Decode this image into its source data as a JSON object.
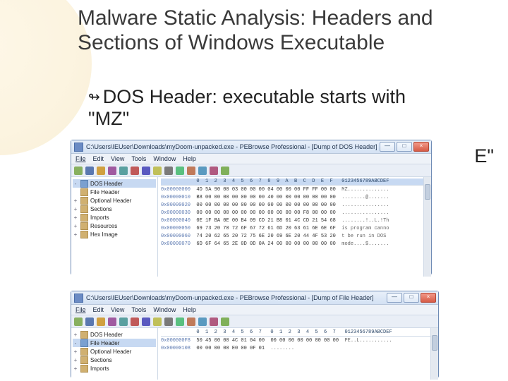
{
  "slide": {
    "title": "Malware Static Analysis: Headers and Sections of Windows Executable",
    "bullet1_prefix": "DOS Header:  executable starts with",
    "bullet1_mz": "\"MZ\"",
    "pe_fragment": "E\""
  },
  "menus": [
    "File",
    "Edit",
    "View",
    "Tools",
    "Window",
    "Help"
  ],
  "window1": {
    "title": "C:\\Users\\IEUser\\Downloads\\myDoom-unpacked.exe - PEBrowse Professional - [Dump of DOS Header]",
    "min": "—",
    "max": "□",
    "close": "×",
    "tree": [
      {
        "exp": "-",
        "label": "DOS Header",
        "sel": true
      },
      {
        "exp": " ",
        "label": "File Header"
      },
      {
        "exp": "+",
        "label": "Optional Header"
      },
      {
        "exp": "+",
        "label": "Sections"
      },
      {
        "exp": "+",
        "label": "Imports"
      },
      {
        "exp": "+",
        "label": "Resources"
      },
      {
        "exp": "+",
        "label": "Hex Image"
      }
    ],
    "hex_header": "            0  1  2  3  4  5  6  7  8  9  A  B  C  D  E  F   0123456789ABCDEF",
    "hex_rows": [
      {
        "addr": "0x00000000",
        "bytes": "4D 5A 90 00 03 00 00 00 04 00 00 00 FF FF 00 00",
        "asc": "MZ.............."
      },
      {
        "addr": "0x00000010",
        "bytes": "B8 00 00 00 00 00 00 00 40 00 00 00 00 00 00 00",
        "asc": "........@......."
      },
      {
        "addr": "0x00000020",
        "bytes": "00 00 00 00 00 00 00 00 00 00 00 00 00 00 00 00",
        "asc": "................"
      },
      {
        "addr": "0x00000030",
        "bytes": "00 00 00 00 00 00 00 00 00 00 00 00 F8 00 00 00",
        "asc": "................"
      },
      {
        "addr": "0x00000040",
        "bytes": "0E 1F BA 0E 00 B4 09 CD 21 B8 01 4C CD 21 54 68",
        "asc": "........!..L.!Th"
      },
      {
        "addr": "0x00000050",
        "bytes": "69 73 20 70 72 6F 67 72 61 6D 20 63 61 6E 6E 6F",
        "asc": "is program canno"
      },
      {
        "addr": "0x00000060",
        "bytes": "74 20 62 65 20 72 75 6E 20 69 6E 20 44 4F 53 20",
        "asc": "t be run in DOS "
      },
      {
        "addr": "0x00000070",
        "bytes": "6D 6F 64 65 2E 0D 0D 0A 24 00 00 00 00 00 00 00",
        "asc": "mode....$......."
      }
    ]
  },
  "window2": {
    "title": "C:\\Users\\IEUser\\Downloads\\myDoom-unpacked.exe - PEBrowse Professional - [Dump of File Header]",
    "min": "—",
    "max": "□",
    "close": "×",
    "tree": [
      {
        "exp": "+",
        "label": "DOS Header"
      },
      {
        "exp": "-",
        "label": "File Header",
        "sel": true
      },
      {
        "exp": "+",
        "label": "Optional Header"
      },
      {
        "exp": "+",
        "label": "Sections"
      },
      {
        "exp": "+",
        "label": "Imports"
      }
    ],
    "hex_header": "            0  1  2  3  4  5  6  7   0  1  2  3  4  5  6  7   0123456789ABCDEF",
    "hex_rows": [
      {
        "addr": "0x000000F8",
        "bytes": "50 45 00 00 4C 01 04 00  00 00 00 00 00 00 00 00",
        "asc": "PE..L..........."
      },
      {
        "addr": "0x00000108",
        "bytes": "00 00 00 00 E0 00 0F 01",
        "asc": "........"
      }
    ]
  }
}
